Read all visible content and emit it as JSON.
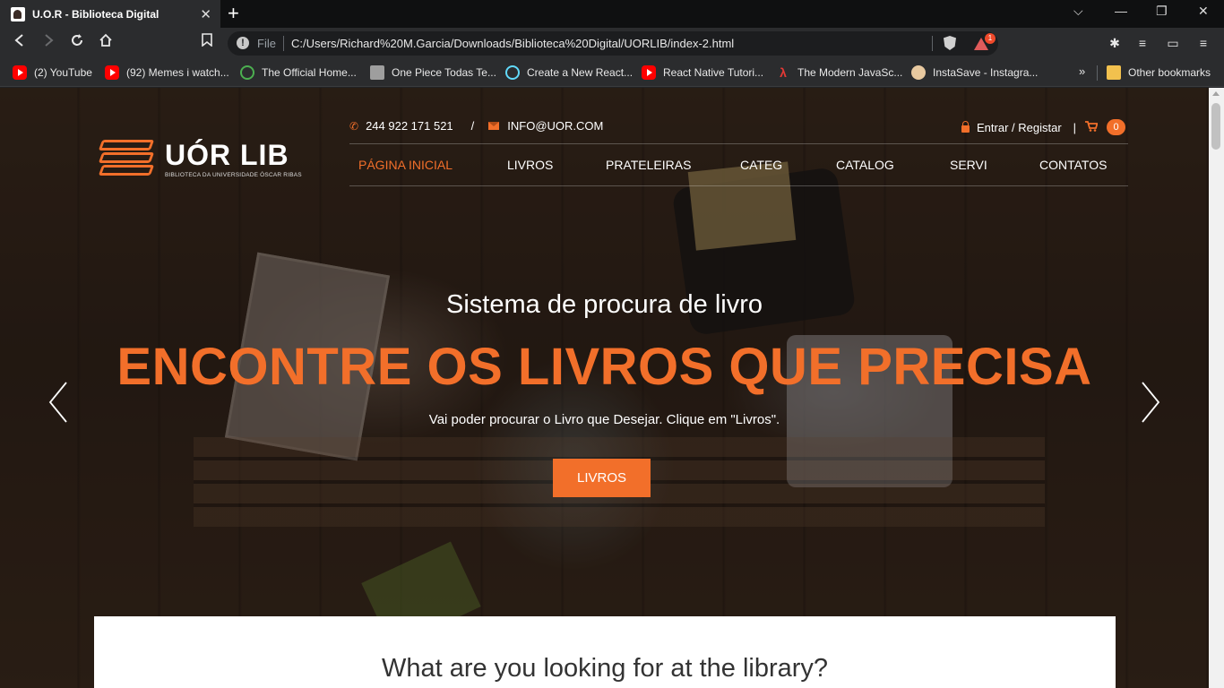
{
  "browser": {
    "tab_title": "U.O.R - Biblioteca Digital",
    "tab_close": "✕",
    "new_tab": "+",
    "window_controls": [
      "⌵",
      "—",
      "❐",
      "✕"
    ],
    "omnibox": {
      "scheme": "File",
      "url": "C:/Users/Richard%20M.Garcia/Downloads/Biblioteca%20Digital/UORLIB/index-2.html",
      "rewards_count": "1"
    },
    "bookmarks": [
      {
        "label": "(2) YouTube",
        "icon": "youtube-icon"
      },
      {
        "label": "(92) Memes i watch...",
        "icon": "youtube-icon"
      },
      {
        "label": "The Official Home...",
        "icon": "leaf-icon"
      },
      {
        "label": "One Piece Todas Te...",
        "icon": "film-icon"
      },
      {
        "label": "Create a New React...",
        "icon": "react-icon"
      },
      {
        "label": "React Native Tutori...",
        "icon": "youtube-icon"
      },
      {
        "label": "The Modern JavaSc...",
        "icon": "javascript-icon"
      },
      {
        "label": "InstaSave - Instagra...",
        "icon": "instasave-icon"
      }
    ],
    "bookmarks_more": "»",
    "other_bookmarks": "Other bookmarks"
  },
  "site": {
    "logo_name": "UÓR LIB",
    "logo_sub": "BIBLIOTECA DA UNIVERSIDADE ÓSCAR RIBAS",
    "phone": "244 922 171 521",
    "slash": "/",
    "email": "INFO@UOR.COM",
    "account": "Entrar / Registar",
    "account_sep": "|",
    "cart_count": "0",
    "nav": [
      "PÁGINA INICIAL",
      "LIVROS",
      "PRATELEIRAS",
      "CATEG",
      "CATALOG",
      "SERVI",
      "CONTATOS"
    ],
    "accent_color": "#f26f2a"
  },
  "hero": {
    "subtitle": "Sistema de procura de livro",
    "title": "ENCONTRE OS LIVROS QUE PRECISA",
    "description": "Vai poder procurar o Livro que Desejar. Clique em \"Livros\".",
    "button": "LIVROS"
  },
  "search_panel": {
    "title": "What are you looking for at the library?"
  }
}
